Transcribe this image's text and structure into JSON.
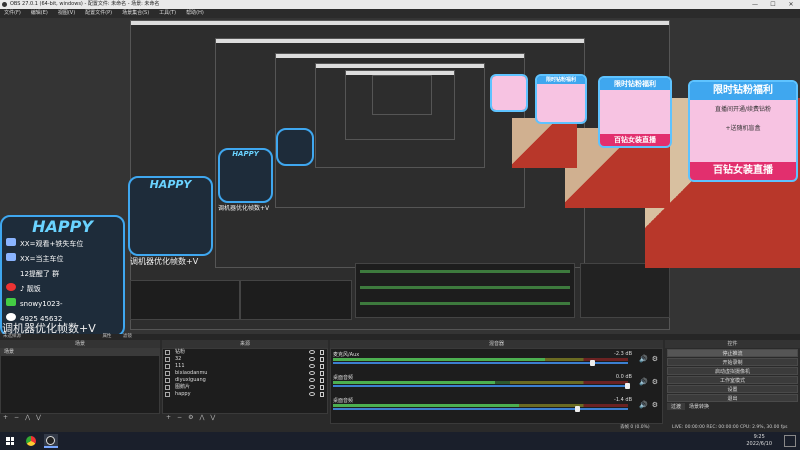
{
  "window": {
    "title": "OBS 27.0.1 (64-bit, windows) - 配置文件: 未命名 - 场景: 未命名",
    "controls": [
      "—",
      "☐",
      "✕"
    ]
  },
  "menu": [
    "文件(F)",
    "编辑(E)",
    "视图(V)",
    "配置文件(P)",
    "场景集合(S)",
    "工具(T)",
    "帮助(H)"
  ],
  "preview": {
    "ad": {
      "header": "限时钻粉福利",
      "line1": "直播间开通/续费钻粉",
      "line2": "+送随机盲盒",
      "footer": "百钻女装直播"
    },
    "happy": {
      "title": "HAPPY",
      "rows": [
        "XX=观看+铁失车位",
        "XX=当主车位",
        "12提醒了 群",
        "♪ 靓饭",
        "snowy1023-",
        "4925 45632"
      ]
    },
    "caption": "调机器优化帧数+V",
    "small_caption": "未选择源",
    "attr_label": "属性",
    "filter_label": "滤镜"
  },
  "docks": {
    "scenes": {
      "title": "场景",
      "items": [
        "场景"
      ]
    },
    "sources": {
      "title": "来源",
      "items": [
        "钻粉",
        "32",
        "111",
        "bixiaodanmu",
        "diyuxiguang",
        "图鹅片",
        "happy"
      ]
    },
    "mixer": {
      "title": "混音器",
      "channels": [
        {
          "name": "麦克风/Aux",
          "db": "-2.3 dB",
          "level": 0.72,
          "volume": 0.88
        },
        {
          "name": "桌面音频",
          "db": "0.0 dB",
          "level": 0.55,
          "volume": 1.0
        },
        {
          "name": "桌面音频",
          "db": "-1.4 dB",
          "level": 0.63,
          "volume": 0.83
        }
      ]
    },
    "controls": {
      "title": "控件",
      "buttons": [
        "停止推流",
        "开始录制",
        "启动虚拟摄像机",
        "工作室模式",
        "设置",
        "退出"
      ]
    },
    "transitions": {
      "tabs": [
        "过渡",
        "场景转换"
      ]
    }
  },
  "status": {
    "text": "LIVE: 00:00:00   REC: 00:00:00   CPU: 2.9%, 30.00 fps",
    "drop": "丢帧 0 (0.0%)"
  },
  "taskbar": {
    "time": "9:25",
    "date": "2022/6/10"
  }
}
